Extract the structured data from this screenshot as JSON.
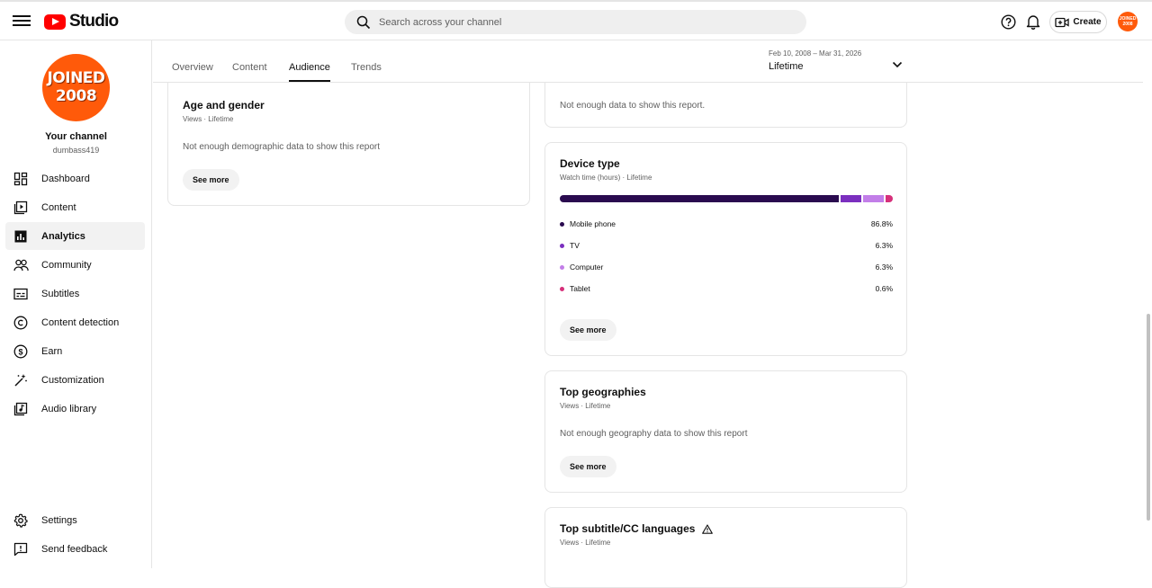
{
  "header": {
    "logo_text": "Studio",
    "search_placeholder": "Search across your channel",
    "create_label": "Create",
    "avatar_text": "JOINED 2008"
  },
  "sidebar": {
    "avatar_text": "JOINED 2008",
    "channel_name": "Your channel",
    "channel_handle": "dumbass419",
    "items": [
      {
        "label": "Dashboard"
      },
      {
        "label": "Content"
      },
      {
        "label": "Analytics"
      },
      {
        "label": "Community"
      },
      {
        "label": "Subtitles"
      },
      {
        "label": "Content detection"
      },
      {
        "label": "Earn"
      },
      {
        "label": "Customization"
      },
      {
        "label": "Audio library"
      }
    ],
    "bottom_items": [
      {
        "label": "Settings"
      },
      {
        "label": "Send feedback"
      }
    ]
  },
  "tabs": [
    {
      "label": "Overview"
    },
    {
      "label": "Content"
    },
    {
      "label": "Audience"
    },
    {
      "label": "Trends"
    }
  ],
  "date_range": {
    "range": "Feb 10, 2008 – Mar 31, 2026",
    "label": "Lifetime"
  },
  "cards": {
    "age_gender": {
      "title": "Age and gender",
      "subtitle": "Views · Lifetime",
      "message": "Not enough demographic data to show this report",
      "button": "See more"
    },
    "partial_top": {
      "message": "Not enough data to show this report."
    },
    "device_type": {
      "title": "Device type",
      "subtitle": "Watch time (hours) · Lifetime",
      "button": "See more",
      "rows": [
        {
          "name": "Mobile phone",
          "percent": "86.8%",
          "value": 86.8,
          "color": "#2a0b4f"
        },
        {
          "name": "TV",
          "percent": "6.3%",
          "value": 6.3,
          "color": "#7b2fbf"
        },
        {
          "name": "Computer",
          "percent": "6.3%",
          "value": 6.3,
          "color": "#c27ee8"
        },
        {
          "name": "Tablet",
          "percent": "0.6%",
          "value": 0.6,
          "color": "#d6307a"
        }
      ]
    },
    "geographies": {
      "title": "Top geographies",
      "subtitle": "Views · Lifetime",
      "message": "Not enough geography data to show this report",
      "button": "See more"
    },
    "subtitles": {
      "title": "Top subtitle/CC languages",
      "subtitle": "Views · Lifetime"
    }
  }
}
